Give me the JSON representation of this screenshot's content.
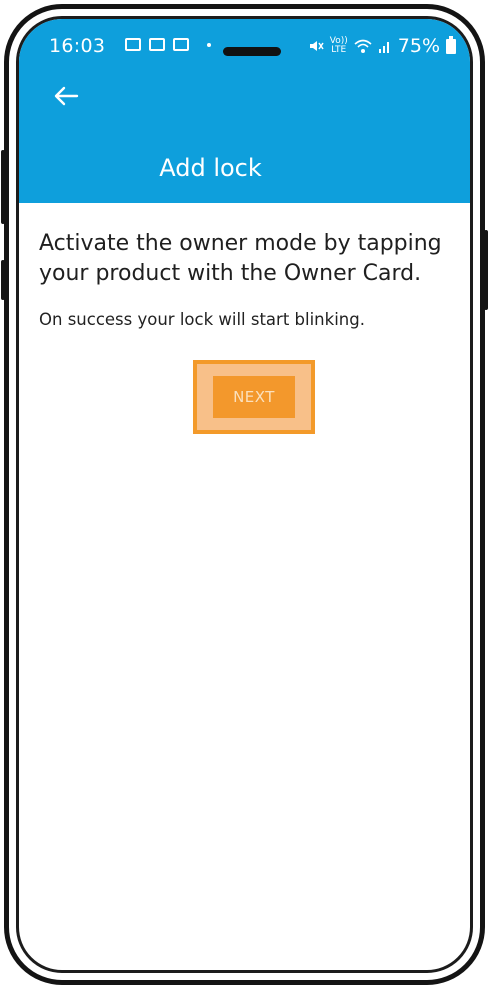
{
  "status_bar": {
    "time": "16:03",
    "network_top": "Vo))",
    "network_bottom": "LTE",
    "battery_percent": "75%"
  },
  "header": {
    "title": "Add lock",
    "background_color": "#0e9fdc"
  },
  "content": {
    "headline": "Activate the owner mode by tapping your product with the Owner Card.",
    "subtext": "On success your lock will start blinking."
  },
  "next_button": {
    "label": "NEXT",
    "color": "#f3982c",
    "highlight_color": "#f39a2a"
  },
  "icons": {
    "back": "arrow-left-icon",
    "gallery": "image-icon",
    "mail": "mail-icon",
    "gmail": "gmail-icon",
    "mute": "mute-icon",
    "wifi": "wifi-icon",
    "signal": "signal-icon",
    "battery": "battery-icon"
  }
}
